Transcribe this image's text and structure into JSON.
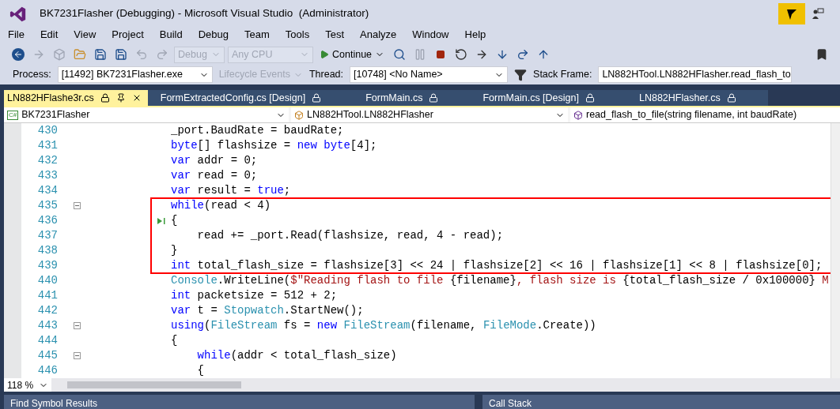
{
  "window": {
    "title": "BK7231Flasher (Debugging) - Microsoft Visual Studio  (Administrator)"
  },
  "menu": [
    "File",
    "Edit",
    "View",
    "Project",
    "Build",
    "Debug",
    "Team",
    "Tools",
    "Test",
    "Analyze",
    "Window",
    "Help"
  ],
  "toolbar": {
    "configuration": {
      "value": "Debug",
      "disabled": true
    },
    "platform": {
      "value": "Any CPU",
      "disabled": true
    },
    "continue_button": "Continue"
  },
  "debug_location": {
    "process_label": "Process:",
    "process": "[11492] BK7231Flasher.exe",
    "lifecycle": {
      "label": "Lifecycle Events",
      "disabled": true
    },
    "thread_label": "Thread:",
    "thread": "[10748] <No Name>",
    "stack_frame_label": "Stack Frame:",
    "stack_frame": "LN882HTool.LN882HFlasher.read_flash_to"
  },
  "tabs": [
    {
      "label": "LN882HFlashe3r.cs",
      "selected": true
    },
    {
      "label": "FormExtractedConfig.cs [Design]",
      "selected": false
    },
    {
      "label": "FormMain.cs",
      "selected": false
    },
    {
      "label": "FormMain.cs [Design]",
      "selected": false
    },
    {
      "label": "LN882HFlasher.cs",
      "selected": false
    }
  ],
  "navigation": {
    "project_badge": "C#",
    "project": "BK7231Flasher",
    "type": "LN882HTool.LN882HFlasher",
    "member": "read_flash_to_file(string filename, int baudRate)"
  },
  "code_lines": [
    {
      "number": "430",
      "fold": false,
      "current": false,
      "tokens": [
        {
          "kind": "plain",
          "text": "_port.BaudRate = baudRate;"
        }
      ]
    },
    {
      "number": "431",
      "fold": false,
      "current": false,
      "tokens": [
        {
          "kind": "keyword",
          "text": "byte"
        },
        {
          "kind": "plain",
          "text": "[] flashsize = "
        },
        {
          "kind": "keyword",
          "text": "new byte"
        },
        {
          "kind": "plain",
          "text": "[4];"
        }
      ]
    },
    {
      "number": "432",
      "fold": false,
      "current": false,
      "tokens": [
        {
          "kind": "keyword",
          "text": "var"
        },
        {
          "kind": "plain",
          "text": " addr = 0;"
        }
      ]
    },
    {
      "number": "433",
      "fold": false,
      "current": false,
      "tokens": [
        {
          "kind": "keyword",
          "text": "var"
        },
        {
          "kind": "plain",
          "text": " read = 0;"
        }
      ]
    },
    {
      "number": "434",
      "fold": false,
      "current": false,
      "tokens": [
        {
          "kind": "keyword",
          "text": "var"
        },
        {
          "kind": "plain",
          "text": " result = "
        },
        {
          "kind": "keyword",
          "text": "true"
        },
        {
          "kind": "plain",
          "text": ";"
        }
      ]
    },
    {
      "number": "435",
      "fold": true,
      "current": false,
      "tokens": [
        {
          "kind": "keyword",
          "text": "while"
        },
        {
          "kind": "plain",
          "text": "(read < 4)"
        }
      ]
    },
    {
      "number": "436",
      "fold": false,
      "current": true,
      "tokens": [
        {
          "kind": "plain",
          "text": "{"
        }
      ]
    },
    {
      "number": "437",
      "fold": false,
      "current": false,
      "tokens": [
        {
          "kind": "plain",
          "text": "    read += _port.Read(flashsize, read, 4 - read);"
        }
      ]
    },
    {
      "number": "438",
      "fold": false,
      "current": false,
      "tokens": [
        {
          "kind": "plain",
          "text": "}"
        }
      ]
    },
    {
      "number": "439",
      "fold": false,
      "current": false,
      "tokens": [
        {
          "kind": "keyword",
          "text": "int"
        },
        {
          "kind": "plain",
          "text": " total_flash_size = flashsize[3] << 24 | flashsize[2] << 16 | flashsize[1] << 8 | flashsize[0];"
        }
      ]
    },
    {
      "number": "440",
      "fold": false,
      "current": false,
      "tokens": [
        {
          "kind": "type",
          "text": "Console"
        },
        {
          "kind": "plain",
          "text": ".WriteLine("
        },
        {
          "kind": "string",
          "text": "$\"Reading flash to file "
        },
        {
          "kind": "plain",
          "text": "{filename}"
        },
        {
          "kind": "string",
          "text": ", flash size is "
        },
        {
          "kind": "plain",
          "text": "{total_flash_size / 0x100000}"
        },
        {
          "kind": "string",
          "text": " M"
        }
      ]
    },
    {
      "number": "441",
      "fold": false,
      "current": false,
      "tokens": [
        {
          "kind": "keyword",
          "text": "int"
        },
        {
          "kind": "plain",
          "text": " packetsize = 512 + 2;"
        }
      ]
    },
    {
      "number": "442",
      "fold": false,
      "current": false,
      "tokens": [
        {
          "kind": "keyword",
          "text": "var"
        },
        {
          "kind": "plain",
          "text": " t = "
        },
        {
          "kind": "type",
          "text": "Stopwatch"
        },
        {
          "kind": "plain",
          "text": ".StartNew();"
        }
      ]
    },
    {
      "number": "443",
      "fold": true,
      "current": false,
      "tokens": [
        {
          "kind": "keyword",
          "text": "using"
        },
        {
          "kind": "plain",
          "text": "("
        },
        {
          "kind": "type",
          "text": "FileStream"
        },
        {
          "kind": "plain",
          "text": " fs = "
        },
        {
          "kind": "keyword",
          "text": "new"
        },
        {
          "kind": "type",
          "text": " FileStream"
        },
        {
          "kind": "plain",
          "text": "(filename, "
        },
        {
          "kind": "type",
          "text": "FileMode"
        },
        {
          "kind": "plain",
          "text": ".Create))"
        }
      ]
    },
    {
      "number": "444",
      "fold": false,
      "current": false,
      "tokens": [
        {
          "kind": "plain",
          "text": "{"
        }
      ]
    },
    {
      "number": "445",
      "fold": true,
      "current": false,
      "tokens": [
        {
          "kind": "keyword",
          "text": "    while"
        },
        {
          "kind": "plain",
          "text": "(addr < total_flash_size)"
        }
      ]
    },
    {
      "number": "446",
      "fold": false,
      "current": false,
      "tokens": [
        {
          "kind": "plain",
          "text": "    {"
        }
      ]
    }
  ],
  "zoom": "118 %",
  "bottom_panels": [
    "Find Symbol Results",
    "Call Stack"
  ]
}
